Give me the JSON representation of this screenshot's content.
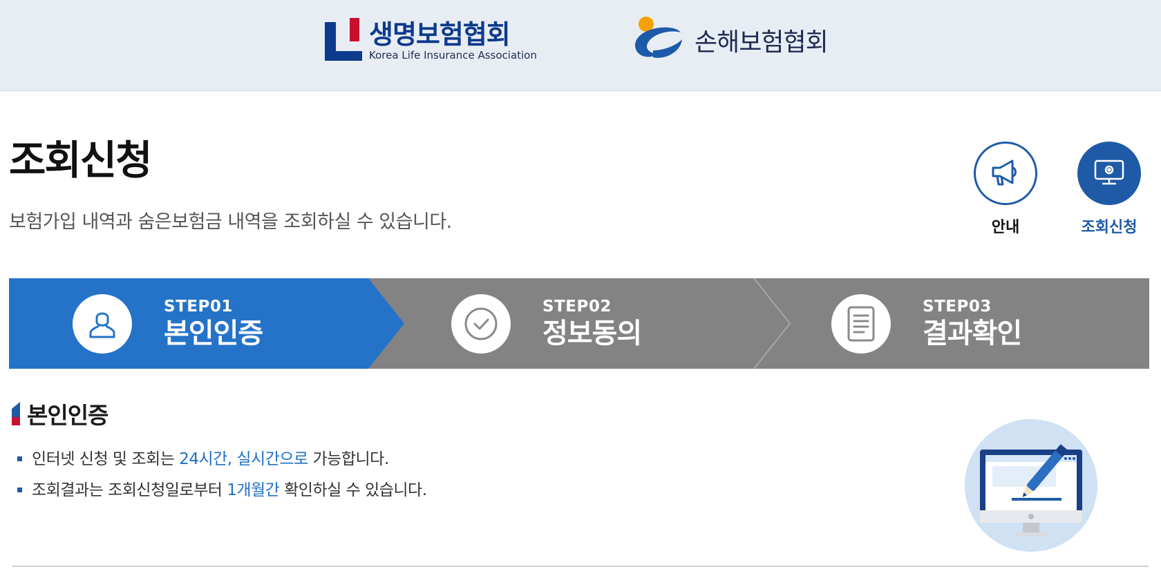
{
  "header": {
    "logo_left": {
      "ko": "생명보험협회",
      "en": "Korea Life Insurance Association"
    },
    "logo_right": {
      "ko": "손해보험협회"
    }
  },
  "page": {
    "title": "조회신청",
    "description": "보험가입 내역과 숨은보험금 내역을 조회하실 수 있습니다."
  },
  "quick_menu": [
    {
      "label": "안내",
      "icon": "megaphone-icon"
    },
    {
      "label": "조회신청",
      "icon": "monitor-settings-icon"
    }
  ],
  "steps": [
    {
      "num": "STEP01",
      "name": "본인인증",
      "icon": "user-icon",
      "active": true
    },
    {
      "num": "STEP02",
      "name": "정보동의",
      "icon": "check-circle-icon",
      "active": false
    },
    {
      "num": "STEP03",
      "name": "결과확인",
      "icon": "document-icon",
      "active": false
    }
  ],
  "section": {
    "title": "본인인증",
    "notes": [
      {
        "before": "인터넷 신청 및 조회는 ",
        "highlight": "24시간, 실시간으로",
        "after": " 가능합니다."
      },
      {
        "before": "조회결과는 조회신청일로부터 ",
        "highlight": "1개월간",
        "after": " 확인하실 수 있습니다."
      }
    ]
  },
  "colors": {
    "active_step": "#2473c9",
    "inactive_step": "#838383",
    "accent_blue": "#1e5aa8",
    "highlight_text": "#1e6fc7",
    "header_bg": "#e8edf4"
  }
}
